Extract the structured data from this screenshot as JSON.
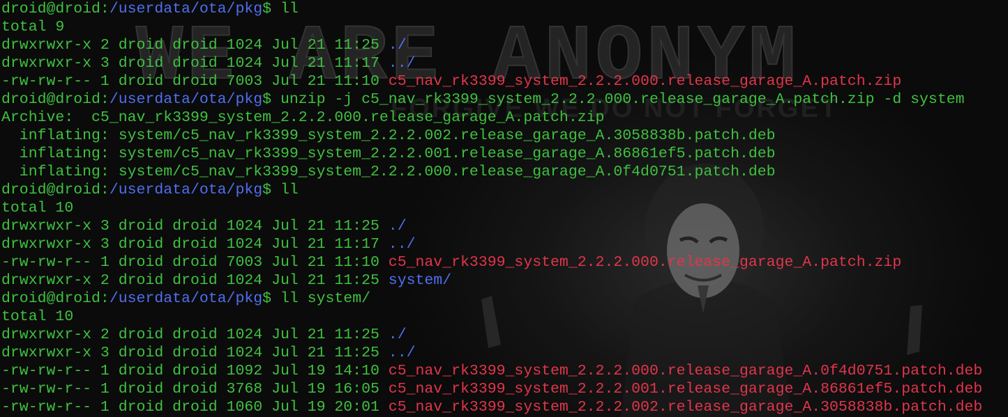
{
  "terminal": {
    "background_text": {
      "line1": "WE ARE ANONYM",
      "line2": "FORGIVE WE DO NOT FORGET"
    },
    "colors": {
      "prompt": "#3fc13f",
      "path": "#4f6ff0",
      "file_zip_deb": "#e1354b",
      "output": "#3fc13f"
    },
    "lines": [
      [
        {
          "text": "droid@droid:",
          "c": "green"
        },
        {
          "text": "/userdata/ota/pkg",
          "c": "blue"
        },
        {
          "text": "$ ll",
          "c": "green"
        }
      ],
      [
        {
          "text": "total 9",
          "c": "green"
        }
      ],
      [
        {
          "text": "drwxrwxr-x 2 droid droid 1024 Jul 21 11:25 ",
          "c": "green"
        },
        {
          "text": "./",
          "c": "blue"
        }
      ],
      [
        {
          "text": "drwxrwxr-x 3 droid droid 1024 Jul 21 11:17 ",
          "c": "green"
        },
        {
          "text": "../",
          "c": "blue"
        }
      ],
      [
        {
          "text": "-rw-rw-r-- 1 droid droid 7003 Jul 21 11:10 ",
          "c": "green"
        },
        {
          "text": "c5_nav_rk3399_system_2.2.2.000.release_garage_A.patch.zip",
          "c": "red"
        }
      ],
      [
        {
          "text": "droid@droid:",
          "c": "green"
        },
        {
          "text": "/userdata/ota/pkg",
          "c": "blue"
        },
        {
          "text": "$ unzip -j c5_nav_rk3399_system_2.2.2.000.release_garage_A.patch.zip -d system",
          "c": "green"
        }
      ],
      [
        {
          "text": "Archive:  c5_nav_rk3399_system_2.2.2.000.release_garage_A.patch.zip",
          "c": "green"
        }
      ],
      [
        {
          "text": "  inflating: system/c5_nav_rk3399_system_2.2.2.002.release_garage_A.3058838b.patch.deb",
          "c": "green"
        }
      ],
      [
        {
          "text": "  inflating: system/c5_nav_rk3399_system_2.2.2.001.release_garage_A.86861ef5.patch.deb",
          "c": "green"
        }
      ],
      [
        {
          "text": "  inflating: system/c5_nav_rk3399_system_2.2.2.000.release_garage_A.0f4d0751.patch.deb",
          "c": "green"
        }
      ],
      [
        {
          "text": "droid@droid:",
          "c": "green"
        },
        {
          "text": "/userdata/ota/pkg",
          "c": "blue"
        },
        {
          "text": "$ ll",
          "c": "green"
        }
      ],
      [
        {
          "text": "total 10",
          "c": "green"
        }
      ],
      [
        {
          "text": "drwxrwxr-x 3 droid droid 1024 Jul 21 11:25 ",
          "c": "green"
        },
        {
          "text": "./",
          "c": "blue"
        }
      ],
      [
        {
          "text": "drwxrwxr-x 3 droid droid 1024 Jul 21 11:17 ",
          "c": "green"
        },
        {
          "text": "../",
          "c": "blue"
        }
      ],
      [
        {
          "text": "-rw-rw-r-- 1 droid droid 7003 Jul 21 11:10 ",
          "c": "green"
        },
        {
          "text": "c5_nav_rk3399_system_2.2.2.000.release_garage_A.patch.zip",
          "c": "red"
        }
      ],
      [
        {
          "text": "drwxrwxr-x 2 droid droid 1024 Jul 21 11:25 ",
          "c": "green"
        },
        {
          "text": "system/",
          "c": "blue"
        }
      ],
      [
        {
          "text": "droid@droid:",
          "c": "green"
        },
        {
          "text": "/userdata/ota/pkg",
          "c": "blue"
        },
        {
          "text": "$ ll system/",
          "c": "green"
        }
      ],
      [
        {
          "text": "total 10",
          "c": "green"
        }
      ],
      [
        {
          "text": "drwxrwxr-x 2 droid droid 1024 Jul 21 11:25 ",
          "c": "green"
        },
        {
          "text": "./",
          "c": "blue"
        }
      ],
      [
        {
          "text": "drwxrwxr-x 3 droid droid 1024 Jul 21 11:25 ",
          "c": "green"
        },
        {
          "text": "../",
          "c": "blue"
        }
      ],
      [
        {
          "text": "-rw-rw-r-- 1 droid droid 1092 Jul 19 14:10 ",
          "c": "green"
        },
        {
          "text": "c5_nav_rk3399_system_2.2.2.000.release_garage_A.0f4d0751.patch.deb",
          "c": "red"
        }
      ],
      [
        {
          "text": "-rw-rw-r-- 1 droid droid 3768 Jul 19 16:05 ",
          "c": "green"
        },
        {
          "text": "c5_nav_rk3399_system_2.2.2.001.release_garage_A.86861ef5.patch.deb",
          "c": "red"
        }
      ],
      [
        {
          "text": "-rw-rw-r-- 1 droid droid 1060 Jul 19 20:01 ",
          "c": "green"
        },
        {
          "text": "c5_nav_rk3399_system_2.2.2.002.release_garage_A.3058838b.patch.deb",
          "c": "red"
        }
      ]
    ]
  }
}
